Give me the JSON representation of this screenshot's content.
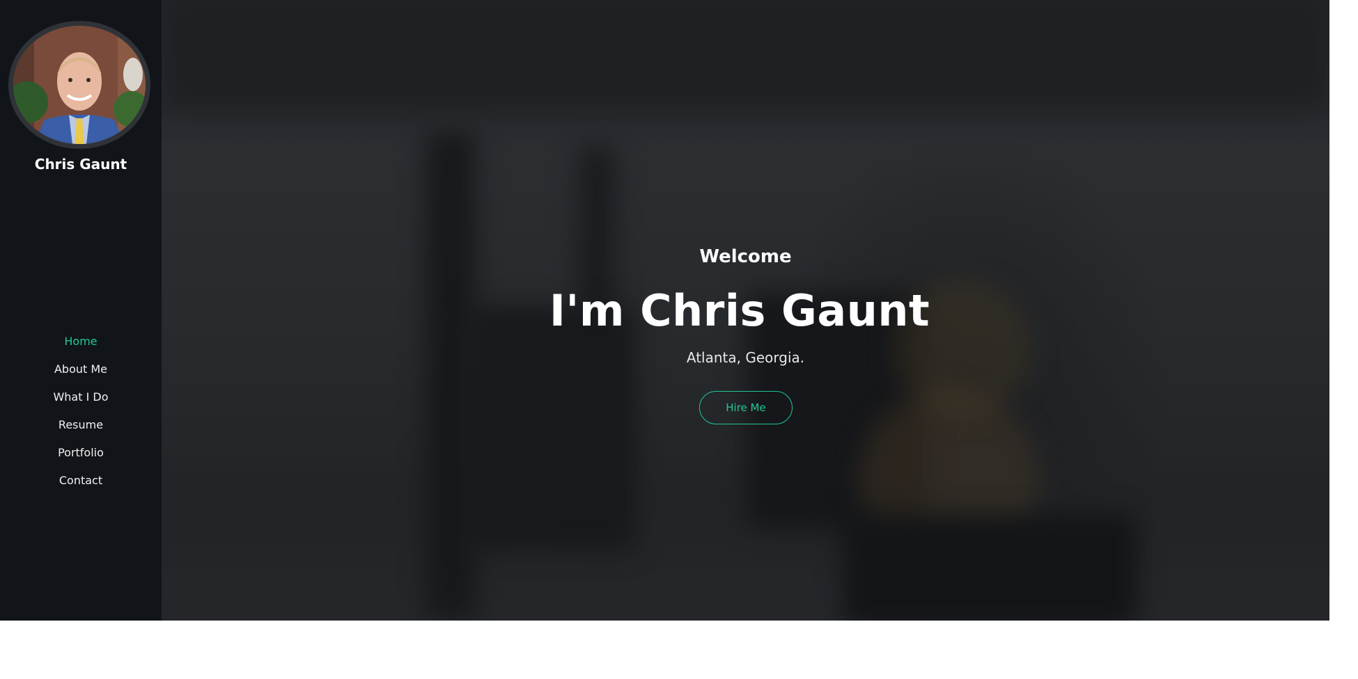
{
  "sidebar": {
    "profile_name": "Chris Gaunt",
    "avatar_icon": "profile-photo",
    "nav": [
      {
        "label": "Home",
        "active": true
      },
      {
        "label": "About Me",
        "active": false
      },
      {
        "label": "What I Do",
        "active": false
      },
      {
        "label": "Resume",
        "active": false
      },
      {
        "label": "Portfolio",
        "active": false
      },
      {
        "label": "Contact",
        "active": false
      }
    ]
  },
  "hero": {
    "welcome": "Welcome",
    "headline": "I'm Chris Gaunt",
    "location": "Atlanta, Georgia.",
    "cta_label": "Hire Me"
  },
  "colors": {
    "accent": "#20c997",
    "sidebar_bg": "#111418",
    "text": "#ffffff"
  }
}
